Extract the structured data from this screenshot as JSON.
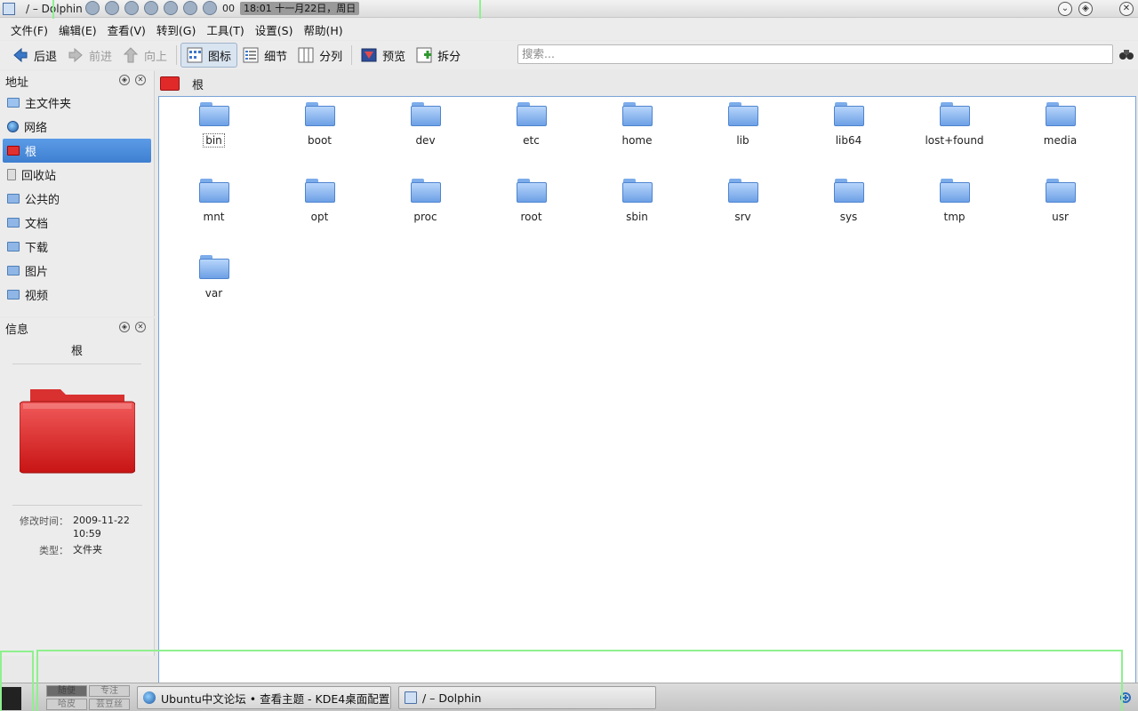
{
  "window": {
    "title": "/ – Dolphin",
    "clock": "18:01 十一月22日，周日",
    "tray_counter": "00"
  },
  "menu": [
    "文件(F)",
    "编辑(E)",
    "查看(V)",
    "转到(G)",
    "工具(T)",
    "设置(S)",
    "帮助(H)"
  ],
  "toolbar": {
    "back": "后退",
    "forward": "前进",
    "up": "向上",
    "icons": "图标",
    "details": "细节",
    "columns": "分列",
    "preview": "预览",
    "split": "拆分",
    "search_placeholder": "搜索..."
  },
  "places": {
    "header": "地址",
    "items": [
      {
        "label": "主文件夹",
        "icon": "home-folder-icon"
      },
      {
        "label": "网络",
        "icon": "network-globe-icon"
      },
      {
        "label": "根",
        "icon": "root-folder-icon",
        "selected": true
      },
      {
        "label": "回收站",
        "icon": "trash-icon"
      },
      {
        "label": "公共的",
        "icon": "folder-icon"
      },
      {
        "label": "文档",
        "icon": "folder-icon"
      },
      {
        "label": "下载",
        "icon": "folder-icon"
      },
      {
        "label": "图片",
        "icon": "folder-icon"
      },
      {
        "label": "视频",
        "icon": "folder-icon"
      }
    ]
  },
  "info": {
    "header": "信息",
    "name": "根",
    "modified_label": "修改时间：",
    "modified_value": "2009-11-22 10:59",
    "type_label": "类型：",
    "type_value": "文件夹"
  },
  "location": {
    "current": "根"
  },
  "files": [
    "bin",
    "boot",
    "dev",
    "etc",
    "home",
    "lib",
    "lib64",
    "lost+found",
    "media",
    "mnt",
    "opt",
    "proc",
    "root",
    "sbin",
    "srv",
    "sys",
    "tmp",
    "usr",
    "var"
  ],
  "taskbar": {
    "pager": [
      "随便",
      "专注",
      "哈皮",
      "芸豆丝"
    ],
    "tasks": [
      {
        "label": "Ubuntu中文论坛 • 查看主题 - KDE4桌面配置",
        "icon": "browser-globe-icon"
      },
      {
        "label": "/ – Dolphin",
        "icon": "dolphin-app-icon"
      }
    ]
  },
  "colors": {
    "selection": "#3e7fd1",
    "folder_blue": "#6da0e6",
    "root_red": "#e02a2a",
    "highlight_frame": "#8ef08e"
  }
}
